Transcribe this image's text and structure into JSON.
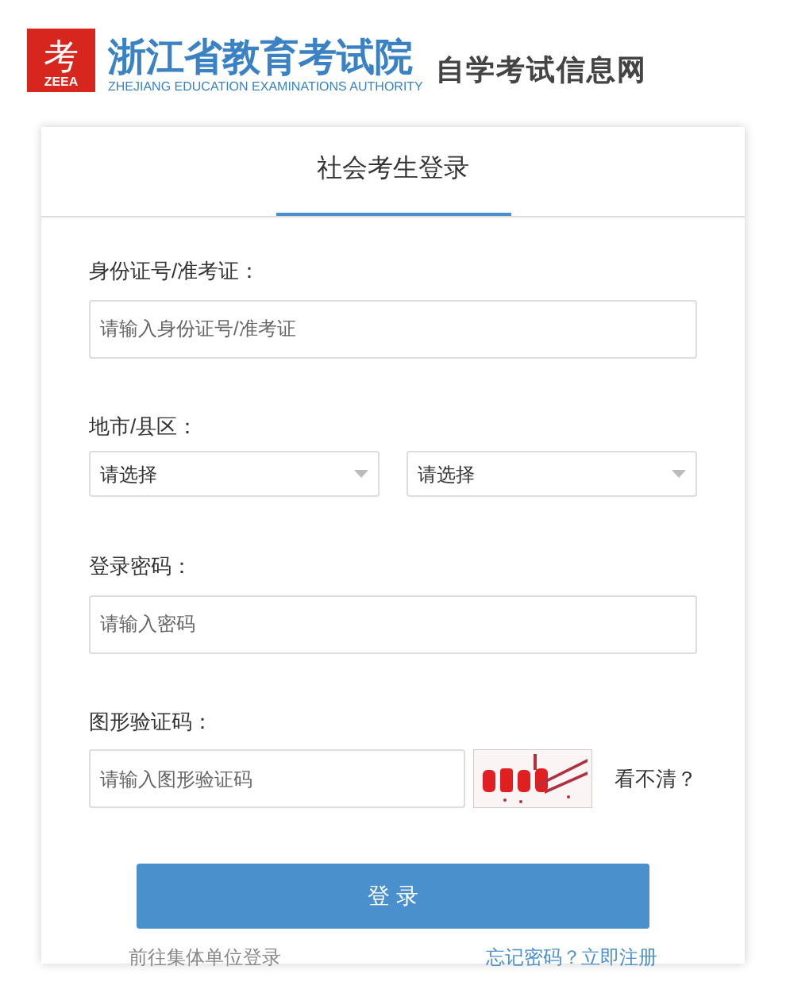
{
  "header": {
    "logo_mark": "考",
    "logo_abbr": "ZEEA",
    "org_name": "浙江省教育考试院",
    "org_name_en": "ZHEJIANG EDUCATION EXAMINATIONS AUTHORITY",
    "site_name": "自学考试信息网"
  },
  "login": {
    "tabs": [
      {
        "label": "社会考生登录",
        "selected": true
      }
    ],
    "id_field": {
      "label": "身份证号/准考证：",
      "placeholder": "请输入身份证号/准考证"
    },
    "region": {
      "label": "地市/县区：",
      "selects": [
        {
          "value": "请选择"
        },
        {
          "value": "请选择"
        }
      ]
    },
    "password": {
      "label": "登录密码：",
      "placeholder": "请输入密码"
    },
    "captcha": {
      "label": "图形验证码：",
      "placeholder": "请输入图形验证码",
      "refresh": "看不清？"
    },
    "submit": "登 录",
    "links": [
      {
        "label": "前往集体单位登录"
      },
      {
        "label": "忘记密码？"
      },
      {
        "label": "立即注册"
      }
    ]
  }
}
